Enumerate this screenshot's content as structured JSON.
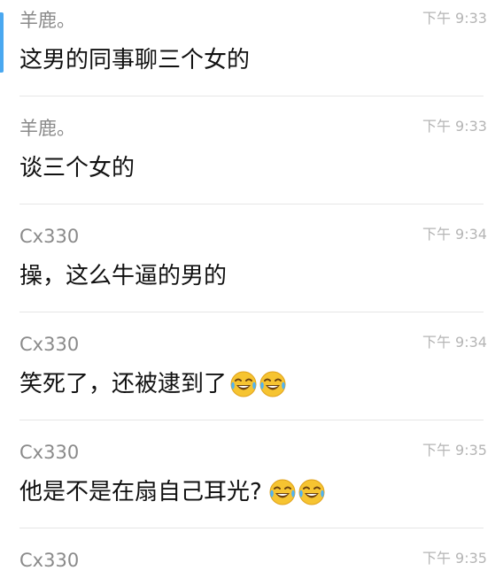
{
  "colors": {
    "accent": "#4aa8f0",
    "sender": "#8a8a8a",
    "time": "#b5b5b5",
    "text": "#111111",
    "divider": "#e6e6e6"
  },
  "messages": [
    {
      "sender": "羊鹿。",
      "time": "下午 9:33",
      "text": "这男的同事聊三个女的",
      "emojis": []
    },
    {
      "sender": "羊鹿。",
      "time": "下午 9:33",
      "text": "谈三个女的",
      "emojis": []
    },
    {
      "sender": "Cx330",
      "time": "下午 9:34",
      "text": "操，这么牛逼的男的",
      "emojis": []
    },
    {
      "sender": "Cx330",
      "time": "下午 9:34",
      "text": "笑死了，还被逮到了",
      "emojis": [
        "tears-of-joy-icon",
        "tears-of-joy-icon"
      ]
    },
    {
      "sender": "Cx330",
      "time": "下午 9:35",
      "text": "他是不是在扇自己耳光?",
      "emojis": [
        "tears-of-joy-icon",
        "tears-of-joy-icon"
      ]
    },
    {
      "sender": "Cx330",
      "time": "下午 9:35",
      "text": "",
      "emojis": []
    }
  ]
}
